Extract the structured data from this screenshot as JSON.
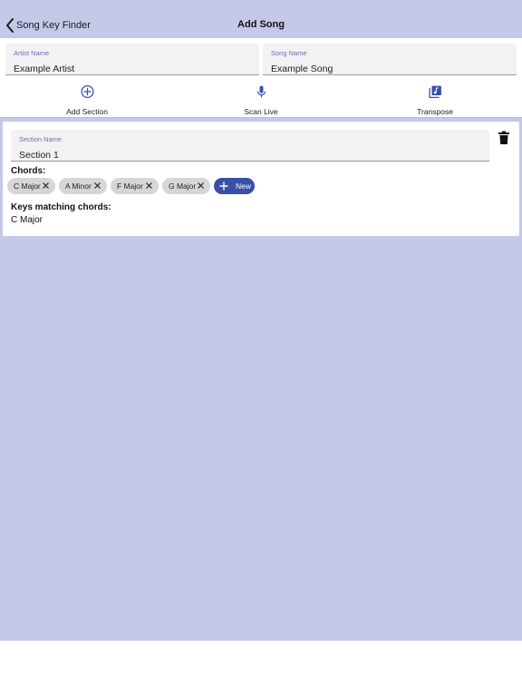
{
  "navbar": {
    "back_label": "Song Key Finder",
    "title": "Add Song"
  },
  "fields": {
    "artist": {
      "label": "Artist Name",
      "value": "Example Artist"
    },
    "song": {
      "label": "Song Name",
      "value": "Example Song"
    }
  },
  "actions": [
    {
      "label": "Add Section",
      "icon": "add-circle-icon"
    },
    {
      "label": "Scan Live",
      "icon": "microphone-icon"
    },
    {
      "label": "Transpose",
      "icon": "music-library-icon"
    }
  ],
  "section": {
    "name_label": "Section Name",
    "name_value": "Section 1",
    "chords_label": "Chords:",
    "chords": [
      {
        "label": "C Major"
      },
      {
        "label": "A Minor"
      },
      {
        "label": "F Major"
      },
      {
        "label": "G Major"
      }
    ],
    "new_label": "New",
    "keys_label": "Keys matching chords:",
    "keys_value": "C Major"
  },
  "colors": {
    "background": "#c5c9e9",
    "accent": "#3a50a6",
    "field_label": "#6c6ec0",
    "chip": "#d6d6d6"
  }
}
